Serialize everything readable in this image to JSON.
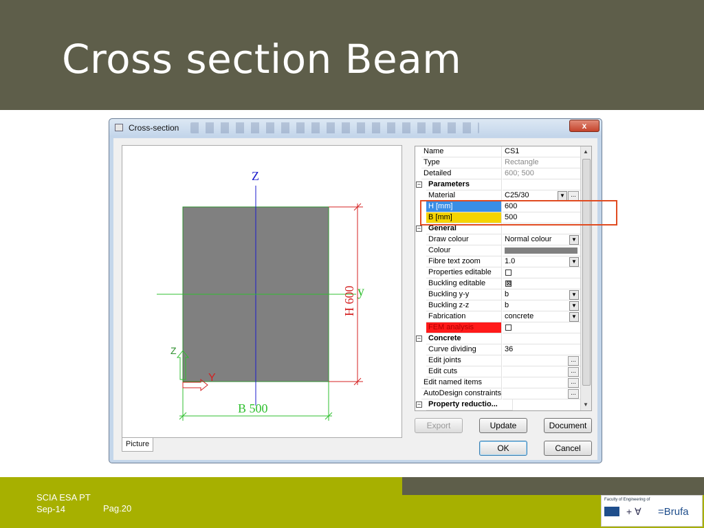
{
  "slide": {
    "title": "Cross section Beam",
    "footer_left_1": "SCIA ESA PT",
    "footer_left_2": "Sep-14",
    "footer_page": "Pag.20",
    "logo_caption": "Faculty of Engineering of",
    "logo_brand": "=Brufa"
  },
  "dialog": {
    "title": "Cross-section",
    "close_label": "x",
    "picture_tab": "Picture",
    "drawing": {
      "z_label": "Z",
      "y_label": "y",
      "height_label": "H 600",
      "width_label": "B 500",
      "local_z": "Z",
      "local_y": "Y"
    },
    "buttons": {
      "export": "Export",
      "update": "Update",
      "document": "Document",
      "ok": "OK",
      "cancel": "Cancel"
    },
    "properties": {
      "name": {
        "label": "Name",
        "value": "CS1"
      },
      "type": {
        "label": "Type",
        "value": "Rectangle"
      },
      "detailed": {
        "label": "Detailed",
        "value": "600; 500"
      },
      "parameters": {
        "label": "Parameters"
      },
      "material": {
        "label": "Material",
        "value": "C25/30"
      },
      "h": {
        "label": "H [mm]",
        "value": "600"
      },
      "b": {
        "label": "B [mm]",
        "value": "500"
      },
      "general": {
        "label": "General"
      },
      "draw_colour": {
        "label": "Draw colour",
        "value": "Normal colour"
      },
      "colour": {
        "label": "Colour"
      },
      "fibre_text_zoom": {
        "label": "Fibre text zoom",
        "value": "1.0"
      },
      "props_editable": {
        "label": "Properties editable"
      },
      "buckling_editable": {
        "label": "Buckling editable"
      },
      "buckling_yy": {
        "label": "Buckling y-y",
        "value": "b"
      },
      "buckling_zz": {
        "label": "Buckling z-z",
        "value": "b"
      },
      "fabrication": {
        "label": "Fabrication",
        "value": "concrete"
      },
      "fem_analysis": {
        "label": "FEM analysis"
      },
      "concrete": {
        "label": "Concrete"
      },
      "curve_dividing": {
        "label": "Curve dividing",
        "value": "36"
      },
      "edit_joints": {
        "label": "Edit joints"
      },
      "edit_cuts": {
        "label": "Edit cuts"
      },
      "edit_named": {
        "label": "Edit named items"
      },
      "autodesign": {
        "label": "AutoDesign constraints"
      },
      "property_reduction": {
        "label": "Property reductio..."
      },
      "dots": "..."
    }
  },
  "colors": {
    "title_band": "#5e5e4a",
    "footer_band": "#a7b000",
    "h_row_highlight": "#3a8ee6",
    "b_row_highlight": "#f5d400",
    "fem_highlight": "#ff1a1a",
    "annotation_box": "#e04a1f",
    "section_fill": "#808080"
  }
}
